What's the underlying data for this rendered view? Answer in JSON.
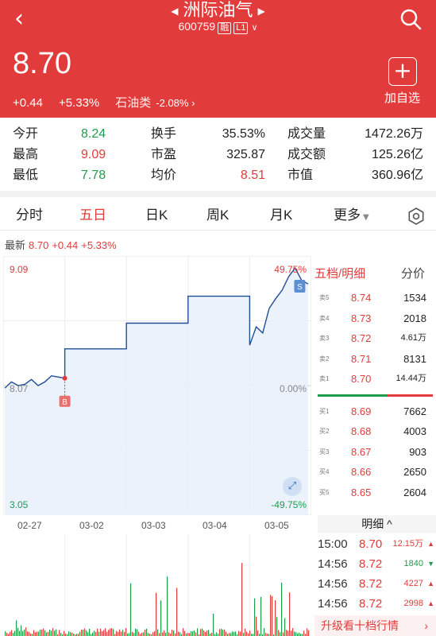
{
  "header": {
    "back_icon": "chevron-left-icon",
    "title": "洲际油气",
    "code": "600759",
    "tag_rong": "融",
    "tag_level": "L1",
    "search_icon": "search-icon",
    "price": "8.70",
    "change": "+0.44",
    "change_pct": "+5.33%",
    "sector": "石油类",
    "sector_change": "-2.08%",
    "add_label": "加自选",
    "brand_color": "#e23b3b"
  },
  "stats": [
    {
      "l1": "今开",
      "v1": "8.24",
      "l2": "换手",
      "v2": "35.53%",
      "l3": "成交量",
      "v3": "1472.26万"
    },
    {
      "l1": "最高",
      "v1": "9.09",
      "l2": "市盈",
      "v2": "325.87",
      "l3": "成交额",
      "v3": "125.26亿"
    },
    {
      "l1": "最低",
      "v1": "7.78",
      "l2": "均价",
      "v2": "8.51",
      "l3": "市值",
      "v3": "360.96亿"
    }
  ],
  "tabs": [
    "分时",
    "五日",
    "日K",
    "周K",
    "月K",
    "更多"
  ],
  "active_tab": "五日",
  "latest": {
    "label": "最新",
    "price": "8.70",
    "change": "+0.44",
    "pct": "+5.33%"
  },
  "chart_data": {
    "type": "line",
    "title": "",
    "y_top_label": "9.09",
    "y_mid_label": "8.07",
    "y_bottom_label": "3.05",
    "pct_top_label": "49.75%",
    "pct_mid_label": "0.00%",
    "pct_bottom_label": "-49.75%",
    "ylim": [
      3.05,
      9.09
    ],
    "x_labels": [
      "02-27",
      "03-02",
      "03-03",
      "03-04",
      "03-05"
    ],
    "series": [
      {
        "values": [
          8.05,
          8.1,
          8.07,
          8.08,
          8.12,
          8.07,
          8.1,
          8.15,
          8.14,
          8.13,
          8.75,
          8.75,
          8.75,
          8.75,
          8.75,
          8.75,
          8.75,
          8.75,
          8.75,
          8.75,
          8.75,
          8.75,
          8.75,
          8.75,
          8.75,
          8.75,
          8.75,
          8.75,
          8.75,
          8.75,
          8.4,
          8.55,
          8.5,
          8.7,
          8.78,
          8.85,
          8.96,
          9.03,
          8.93,
          8.9
        ]
      }
    ],
    "steps": [
      8.13,
      8.48,
      8.78,
      9.08,
      9.35
    ],
    "marker_b": "B",
    "marker_s": "S"
  },
  "orderbook": {
    "title": "五档/明细",
    "title2": "分价",
    "asks": [
      {
        "k": "卖5",
        "p": "8.74",
        "q": "1534"
      },
      {
        "k": "卖4",
        "p": "8.73",
        "q": "2018"
      },
      {
        "k": "卖3",
        "p": "8.72",
        "q": "4.61万"
      },
      {
        "k": "卖2",
        "p": "8.71",
        "q": "8131"
      },
      {
        "k": "卖1",
        "p": "8.70",
        "q": "14.44万"
      }
    ],
    "bids": [
      {
        "k": "买1",
        "p": "8.69",
        "q": "7662"
      },
      {
        "k": "买2",
        "p": "8.68",
        "q": "4003"
      },
      {
        "k": "买3",
        "p": "8.67",
        "q": "903"
      },
      {
        "k": "买4",
        "p": "8.66",
        "q": "2650"
      },
      {
        "k": "买5",
        "p": "8.65",
        "q": "2604"
      }
    ]
  },
  "detail_tab": "明细 ^",
  "trades": [
    {
      "t": "15:00",
      "p": "8.70",
      "v": "12.15万",
      "dir": "up"
    },
    {
      "t": "14:56",
      "p": "8.72",
      "v": "1840",
      "dir": "down"
    },
    {
      "t": "14:56",
      "p": "8.72",
      "v": "4227",
      "dir": "up"
    },
    {
      "t": "14:56",
      "p": "8.72",
      "v": "2998",
      "dir": "up"
    }
  ],
  "upgrade_label": "升级看十档行情"
}
